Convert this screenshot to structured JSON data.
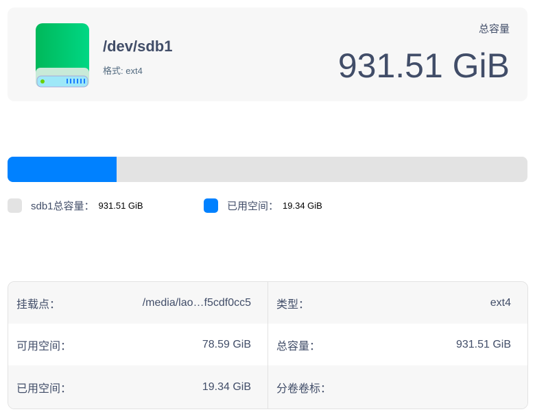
{
  "header": {
    "device": "/dev/sdb1",
    "format": "格式: ext4",
    "capacity_label": "总容量",
    "capacity_value": "931.51 GiB"
  },
  "usage": {
    "fill_fraction": 0.21,
    "used_color": "#0081ff",
    "total_color": "#e3e3e3"
  },
  "legend": [
    {
      "label": "sdb1总容量：",
      "value": "931.51 GiB"
    },
    {
      "label": "已用空间：",
      "value": "19.34 GiB"
    }
  ],
  "table": {
    "rows": [
      [
        {
          "label": "挂载点：",
          "value": "/media/lao…f5cdf0cc5"
        },
        {
          "label": "类型：",
          "value": "ext4"
        }
      ],
      [
        {
          "label": "可用空间：",
          "value": "78.59 GiB"
        },
        {
          "label": "总容量：",
          "value": "931.51 GiB"
        }
      ],
      [
        {
          "label": "已用空间：",
          "value": "19.34 GiB"
        },
        {
          "label": "分卷卷标：",
          "value": ""
        }
      ]
    ]
  }
}
